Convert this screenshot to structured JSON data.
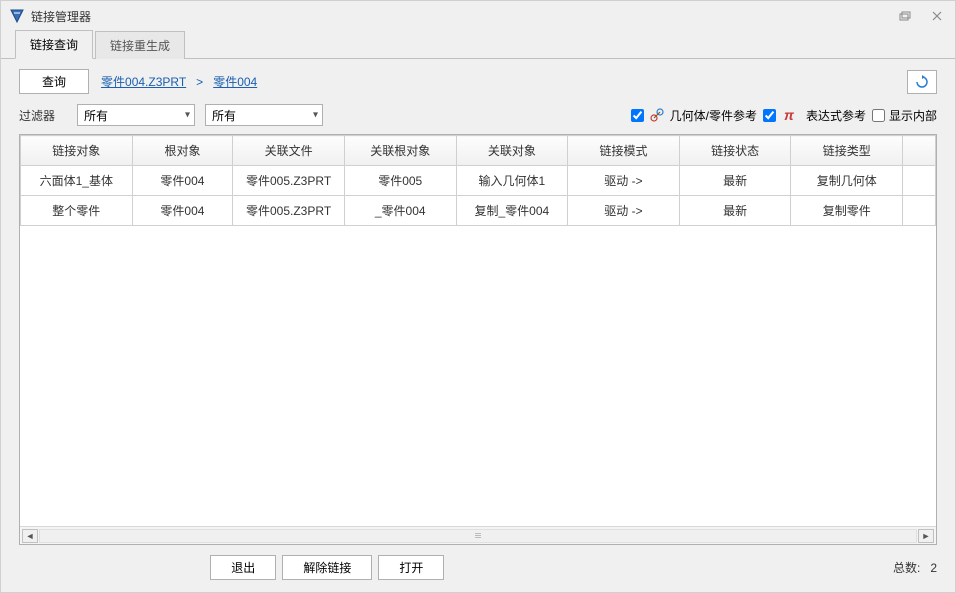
{
  "window": {
    "title": "链接管理器"
  },
  "tabs": {
    "query": "链接查询",
    "regen": "链接重生成"
  },
  "toolbar": {
    "query_btn": "查询"
  },
  "breadcrumb": {
    "item1": "零件004.Z3PRT",
    "sep": ">",
    "item2": "零件004"
  },
  "filter": {
    "label": "过滤器",
    "dd1": "所有",
    "dd2": "所有"
  },
  "checks": {
    "geom": "几何体/零件参考",
    "expr": "表达式参考",
    "internal": "显示内部"
  },
  "table": {
    "headers": [
      "链接对象",
      "根对象",
      "关联文件",
      "关联根对象",
      "关联对象",
      "链接模式",
      "链接状态",
      "链接类型"
    ],
    "rows": [
      [
        "六面体1_基体",
        "零件004",
        "零件005.Z3PRT",
        "零件005",
        "输入几何体1",
        "驱动 ->",
        "最新",
        "复制几何体"
      ],
      [
        "整个零件",
        "零件004",
        "零件005.Z3PRT",
        "_零件004",
        "复制_零件004",
        "驱动 ->",
        "最新",
        "复制零件"
      ]
    ]
  },
  "footer": {
    "exit": "退出",
    "unlink": "解除链接",
    "open": "打开",
    "total_label": "总数:",
    "total_value": "2"
  }
}
